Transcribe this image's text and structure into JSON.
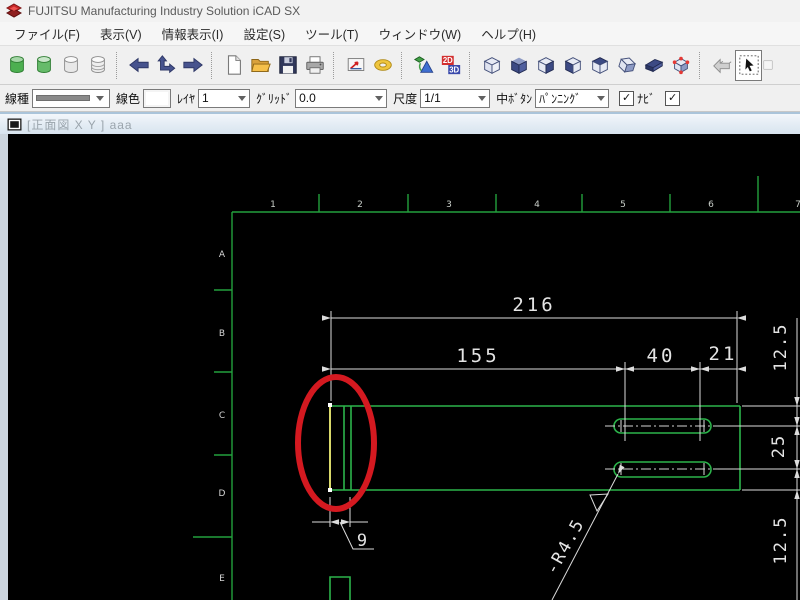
{
  "window": {
    "title": "FUJITSU Manufacturing Industry Solution iCAD SX"
  },
  "menu": {
    "items": [
      {
        "label": "ファイル(F)"
      },
      {
        "label": "表示(V)"
      },
      {
        "label": "情報表示(I)"
      },
      {
        "label": "設定(S)"
      },
      {
        "label": "ツール(T)"
      },
      {
        "label": "ウィンドウ(W)"
      },
      {
        "label": "ヘルプ(H)"
      }
    ]
  },
  "toolbar": {
    "badge_2d": "2D",
    "badge_3d": "3D"
  },
  "fields": {
    "line_type_label": "線種",
    "line_color_label": "線色",
    "layer_label": "ﾚｲﾔ",
    "layer_value": "1",
    "grid_label": "ｸﾞﾘｯﾄﾞ",
    "grid_value": "0.0",
    "scale_label": "尺度",
    "scale_value": "1/1",
    "middle_button_label": "中ﾎﾞﾀﾝ",
    "middle_button_value": "ﾊﾟﾝﾆﾝｸﾞ",
    "navi_label": "ﾅﾋﾞ",
    "navi_checked": "✓",
    "second_checked": "✓"
  },
  "tab": {
    "title": "[正面図  X Y  ] aaa"
  },
  "drawing": {
    "ruler_cols": [
      "1",
      "2",
      "3",
      "4",
      "5",
      "6",
      "7"
    ],
    "ruler_rows": [
      "A",
      "B",
      "C",
      "D",
      "E"
    ],
    "dims": {
      "total_width": "216",
      "left_width": "155",
      "slot_length": "40",
      "right_offset": "21",
      "top_right": "12.5",
      "slot_pitch": "25",
      "bottom_right": "12.5",
      "edge_width": "9",
      "slot_radius": "-R4.5"
    }
  }
}
